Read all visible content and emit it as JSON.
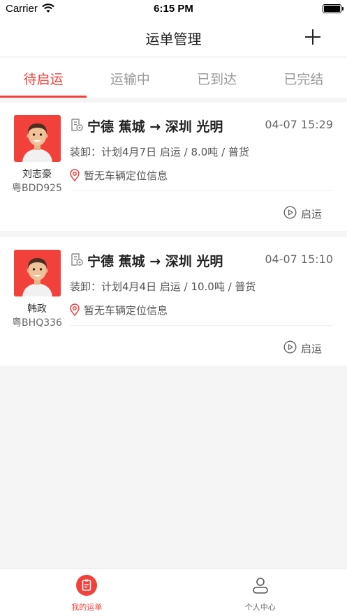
{
  "status_bar": {
    "carrier": "Carrier",
    "time": "6:15 PM"
  },
  "nav": {
    "title": "运单管理"
  },
  "tabs": [
    {
      "label": "待启运",
      "active": true
    },
    {
      "label": "运输中",
      "active": false
    },
    {
      "label": "已到达",
      "active": false
    },
    {
      "label": "已完结",
      "active": false
    }
  ],
  "orders": [
    {
      "driver_name": "刘志豪",
      "plate": "粤BDD925",
      "route": "宁德 蕉城 → 深圳 光明",
      "time": "04-07 15:29",
      "load_info": "装卸：计划4月7日 启运 / 8.0吨 / 普货",
      "location": "暂无车辆定位信息",
      "action": "启运"
    },
    {
      "driver_name": "韩政",
      "plate": "粤BHQ336",
      "route": "宁德 蕉城 → 深圳 光明",
      "time": "04-07 15:10",
      "load_info": "装卸：计划4月4日 启运 / 10.0吨 / 普货",
      "location": "暂无车辆定位信息",
      "action": "启运"
    }
  ],
  "tab_bar": [
    {
      "label": "我的运单",
      "icon": "clipboard-icon",
      "active": true
    },
    {
      "label": "个人中心",
      "icon": "user-icon",
      "active": false
    }
  ],
  "colors": {
    "accent": "#f2403a"
  }
}
